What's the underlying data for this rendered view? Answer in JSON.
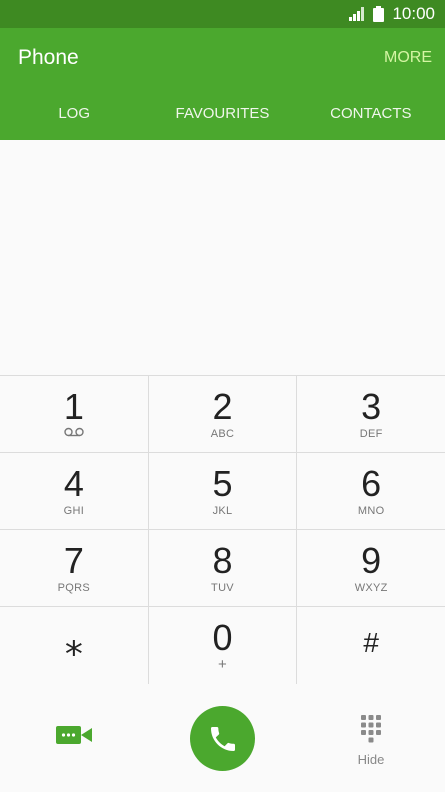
{
  "status": {
    "time": "10:00",
    "signal_icon": "signal-icon",
    "battery_icon": "battery-icon"
  },
  "appbar": {
    "title": "Phone",
    "more_label": "MORE"
  },
  "tabs": [
    {
      "label": "LOG"
    },
    {
      "label": "FAVOURITES"
    },
    {
      "label": "CONTACTS"
    }
  ],
  "keypad": {
    "rows": [
      [
        {
          "digit": "1",
          "letters": ""
        },
        {
          "digit": "2",
          "letters": "ABC"
        },
        {
          "digit": "3",
          "letters": "DEF"
        }
      ],
      [
        {
          "digit": "4",
          "letters": "GHI"
        },
        {
          "digit": "5",
          "letters": "JKL"
        },
        {
          "digit": "6",
          "letters": "MNO"
        }
      ],
      [
        {
          "digit": "7",
          "letters": "PQRS"
        },
        {
          "digit": "8",
          "letters": "TUV"
        },
        {
          "digit": "9",
          "letters": "WXYZ"
        }
      ],
      [
        {
          "digit": "⁎",
          "letters": ""
        },
        {
          "digit": "0",
          "letters": "+"
        },
        {
          "digit": "#",
          "letters": ""
        }
      ]
    ]
  },
  "bottom": {
    "hide_label": "Hide"
  },
  "colors": {
    "accent": "#4ba82e",
    "status_bar": "#3e8a22",
    "more": "#d4f5a3"
  }
}
